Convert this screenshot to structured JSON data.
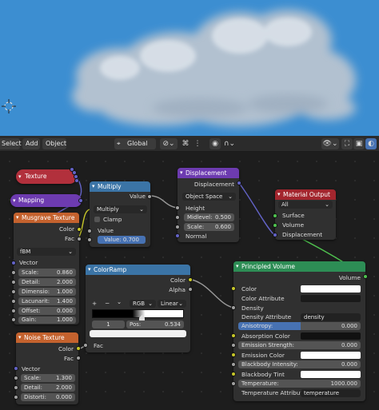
{
  "header": {
    "select": "Select",
    "add": "Add",
    "object": "Object",
    "orientation": "Global"
  },
  "icons": [
    "cursor-icon",
    "transform-orientation-icon",
    "pivot-icon",
    "snap-icon",
    "proportional-icon",
    "visibility-icon",
    "overlay-icon",
    "xray-icon",
    "shading-icon"
  ],
  "nodes": {
    "texcoord": {
      "title": "Texture Coordinate"
    },
    "mapping": {
      "title": "Mapping"
    },
    "multiply": {
      "title": "Multiply",
      "output": "Value",
      "mode": "Multiply",
      "clamp": "Clamp",
      "input1": "Value",
      "input2_label": "Value:",
      "input2_value": "0.700"
    },
    "displacement": {
      "title": "Displacement",
      "output": "Displacement",
      "space": "Object Space",
      "height": "Height",
      "midlevel_label": "Midlevel:",
      "midlevel": "0.500",
      "scale_label": "Scale:",
      "scale": "0.600",
      "normal": "Normal"
    },
    "matout": {
      "title": "Material Output",
      "target": "All",
      "surface": "Surface",
      "volume": "Volume",
      "displacement": "Displacement"
    },
    "musgrave": {
      "title": "Musgrave Texture",
      "out_color": "Color",
      "out_fac": "Fac",
      "type": "fBM",
      "vector": "Vector",
      "params": [
        {
          "label": "Scale:",
          "value": "0.860"
        },
        {
          "label": "Detail:",
          "value": "2.000"
        },
        {
          "label": "Dimensio:",
          "value": "1.000"
        },
        {
          "label": "Lacunarit:",
          "value": "1.400"
        },
        {
          "label": "Offset:",
          "value": "0.000"
        },
        {
          "label": "Gain:",
          "value": "1.000"
        }
      ]
    },
    "colorramp": {
      "title": "ColorRamp",
      "out_color": "Color",
      "out_alpha": "Alpha",
      "add": "+",
      "remove": "−",
      "menu": "⌄",
      "mode": "RGB",
      "interp": "Linear",
      "index": "1",
      "pos_label": "Pos:",
      "pos": "0.534",
      "fac": "Fac"
    },
    "noise": {
      "title": "Noise Texture",
      "out_color": "Color",
      "out_fac": "Fac",
      "vector": "Vector",
      "params": [
        {
          "label": "Scale:",
          "value": "1.300"
        },
        {
          "label": "Detail:",
          "value": "2.000"
        },
        {
          "label": "Distorti:",
          "value": "0.000"
        }
      ]
    },
    "volume": {
      "title": "Principled Volume",
      "output": "Volume",
      "color": "Color",
      "color_attr": "Color Attribute",
      "density": "Density",
      "density_attr_label": "Density Attribute",
      "density_attr": "density",
      "anisotropy_label": "Anisotropy:",
      "anisotropy": "0.000",
      "absorption": "Absorption Color",
      "emission_strength_label": "Emission Strength:",
      "emission_strength": "0.000",
      "emission_color": "Emission Color",
      "blackbody_label": "Blackbody Intensity:",
      "blackbody": "0.000",
      "blackbody_tint": "Blackbody Tint",
      "temperature_label": "Temperature:",
      "temperature": "1000.000",
      "temp_attr_label": "Temperature Attribute",
      "temp_attr": "temperature"
    }
  }
}
